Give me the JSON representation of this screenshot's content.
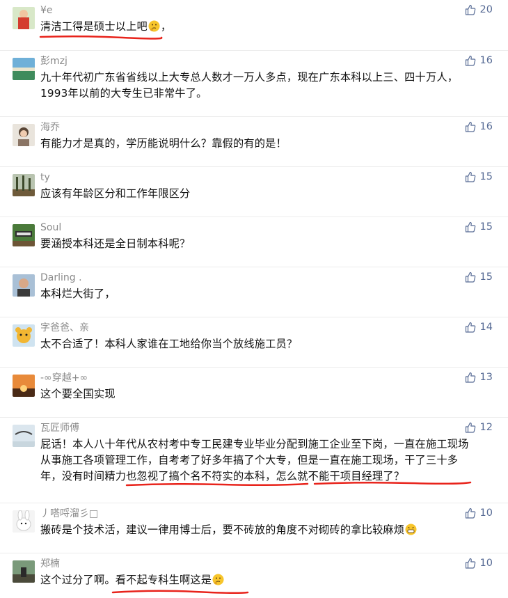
{
  "comments": [
    {
      "name": "¥e",
      "text": "清洁工得是硕士以上吧",
      "suffix": "，",
      "likes": "20",
      "emoji": "thinking-face"
    },
    {
      "name": "彭mzj",
      "text": "九十年代初广东省省线以上大专总人数才一万人多点，现在广东本科以上三、四十万人，1993年以前的大专生已非常牛了。",
      "likes": "16"
    },
    {
      "name": "海乔",
      "text": "有能力才是真的，学历能说明什么？靠假的有的是！",
      "likes": "16"
    },
    {
      "name": "ty",
      "text": "应该有年龄区分和工作年限区分",
      "likes": "15"
    },
    {
      "name": "Soul",
      "text": "要涵授本科还是全日制本科呢？",
      "likes": "15"
    },
    {
      "name": "Darling .",
      "text": "本科烂大街了，",
      "likes": "15"
    },
    {
      "name": "字爸爸、亲",
      "text": "太不合适了！本科人家谁在工地给你当个放线施工员？",
      "likes": "14"
    },
    {
      "name": "-∞穿越+∞",
      "text": "这个要全国实现",
      "likes": "13"
    },
    {
      "name": "瓦匠师傅",
      "text": "屁话！本人八十年代从农村考中专工民建专业毕业分配到施工企业至下岗，一直在施工现场从事施工各项管理工作，自考考了好多年搞了个大专，但是一直在施工现场，干了三十多年，没有时间精力也忽视了搞个名不符实的本科，怎么就不能干项目经理了？",
      "likes": "12"
    },
    {
      "name": "丿嗒哷溜彡□",
      "text": "搬砖是个技术活，建议一律用博士后，要不砖放的角度不对砌砖的拿比较麻烦",
      "likes": "10",
      "emoji": "grinning-face"
    },
    {
      "name": "郑楠",
      "text": "这个过分了啊。看不起专科生啊这是",
      "likes": "10",
      "emoji": "thinking-face"
    }
  ],
  "colors": {
    "name": "#8a8a8a",
    "like": "#576b95",
    "underline": "#e8231b",
    "divider": "#ececec"
  }
}
